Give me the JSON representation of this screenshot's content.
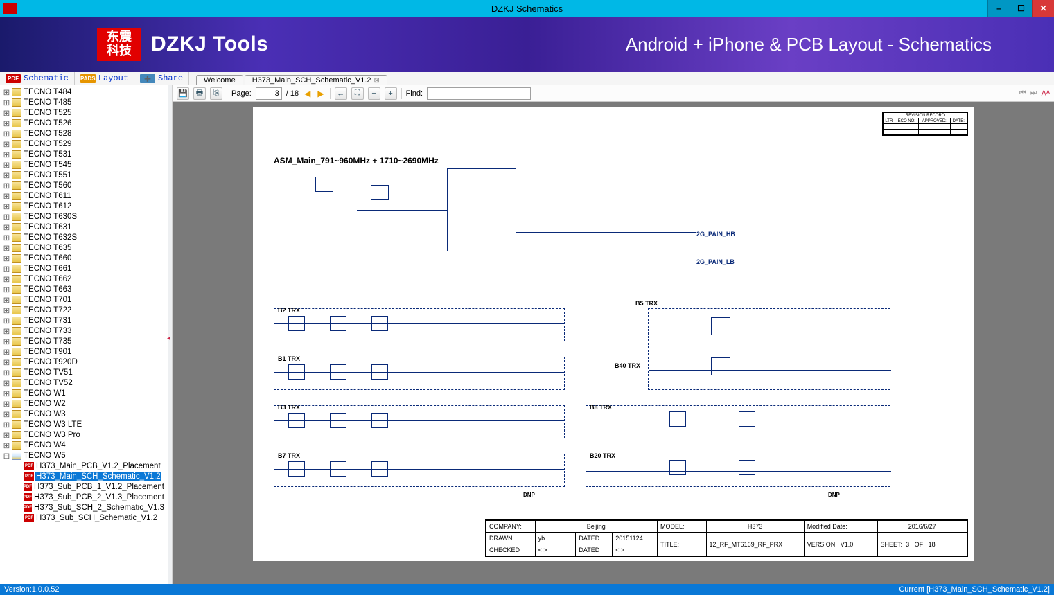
{
  "window": {
    "title": "DZKJ Schematics",
    "min_glyph": "–",
    "max_glyph": "☐",
    "close_glyph": "✕"
  },
  "banner": {
    "logo_cn": "东震\n科技",
    "logo_txt": "DZKJ Tools",
    "tagline": "Android + iPhone & PCB Layout - Schematics"
  },
  "mode_tabs": [
    {
      "icon": "PDF",
      "icon_cls": "mi-pdf",
      "label": "Schematic"
    },
    {
      "icon": "PADS",
      "icon_cls": "mi-pads",
      "label": "Layout"
    },
    {
      "icon": "➕",
      "icon_cls": "mi-share",
      "label": "Share"
    }
  ],
  "doc_tabs": [
    {
      "label": "Welcome",
      "closable": false
    },
    {
      "label": "H373_Main_SCH_Schematic_V1.2",
      "closable": true
    }
  ],
  "tree": {
    "folders": [
      "TECNO T484",
      "TECNO T485",
      "TECNO T525",
      "TECNO T526",
      "TECNO T528",
      "TECNO T529",
      "TECNO T531",
      "TECNO T545",
      "TECNO T551",
      "TECNO T560",
      "TECNO T611",
      "TECNO T612",
      "TECNO T630S",
      "TECNO T631",
      "TECNO T632S",
      "TECNO T635",
      "TECNO T660",
      "TECNO T661",
      "TECNO T662",
      "TECNO T663",
      "TECNO T701",
      "TECNO T722",
      "TECNO T731",
      "TECNO T733",
      "TECNO T735",
      "TECNO T901",
      "TECNO T920D",
      "TECNO TV51",
      "TECNO TV52",
      "TECNO W1",
      "TECNO W2",
      "TECNO W3",
      "TECNO W3 LTE",
      "TECNO W3 Pro",
      "TECNO W4"
    ],
    "open_folder": "TECNO W5",
    "files": [
      "H373_Main_PCB_V1.2_Placement",
      "H373_Main_SCH_Schematic_V1.2",
      "H373_Sub_PCB_1_V1.2_Placement",
      "H373_Sub_PCB_2_V1.3_Placement",
      "H373_Sub_SCH_2_Schematic_V1.3",
      "H373_Sub_SCH_Schematic_V1.2"
    ],
    "selected_file": "H373_Main_SCH_Schematic_V1.2"
  },
  "viewer_toolbar": {
    "page_label": "Page:",
    "page_current": "3",
    "page_total": "/ 18",
    "find_label": "Find:",
    "find_value": ""
  },
  "schematic": {
    "header_text": "ASM_Main_791~960MHz + 1710~2690MHz",
    "nets": {
      "pain_hb": "2G_PAIN_HB",
      "pain_lb": "2G_PAIN_LB"
    },
    "revision_header": "REVISION RECORD",
    "rev_cols": [
      "LTR",
      "ECO NO:",
      "APPROVED:",
      "DATE:"
    ],
    "trx_left": [
      "B2 TRX",
      "B1 TRX",
      "B3 TRX",
      "B7 TRX"
    ],
    "trx_right": [
      "B5  TRX",
      "B40 TRX",
      "B8 TRX",
      "B20 TRX"
    ],
    "dnp": "DNP"
  },
  "titleblock": {
    "company_l": "COMPANY:",
    "company_v": "Beijing",
    "drawn_l": "DRAWN",
    "drawn_v": "yb",
    "dated_l": "DATED",
    "dated_v": "20151124",
    "checked_l": "CHECKED",
    "checked_v": "< >",
    "dated2_l": "DATED",
    "dated2_v": "< >",
    "model_l": "MODEL:",
    "model_v": "H373",
    "title_l": "TITLE:",
    "title_v": "12_RF_MT6169_RF_PRX",
    "moddate_l": "Modified Date:",
    "moddate_v": "2016/6/27",
    "version_l": "VERSION:",
    "version_v": "V1.0",
    "sheet_l": "SHEET:",
    "sheet_v": "3",
    "of_l": "OF",
    "of_v": "18"
  },
  "status": {
    "version": "Version:1.0.0.52",
    "current": "Current [H373_Main_SCH_Schematic_V1.2]"
  }
}
